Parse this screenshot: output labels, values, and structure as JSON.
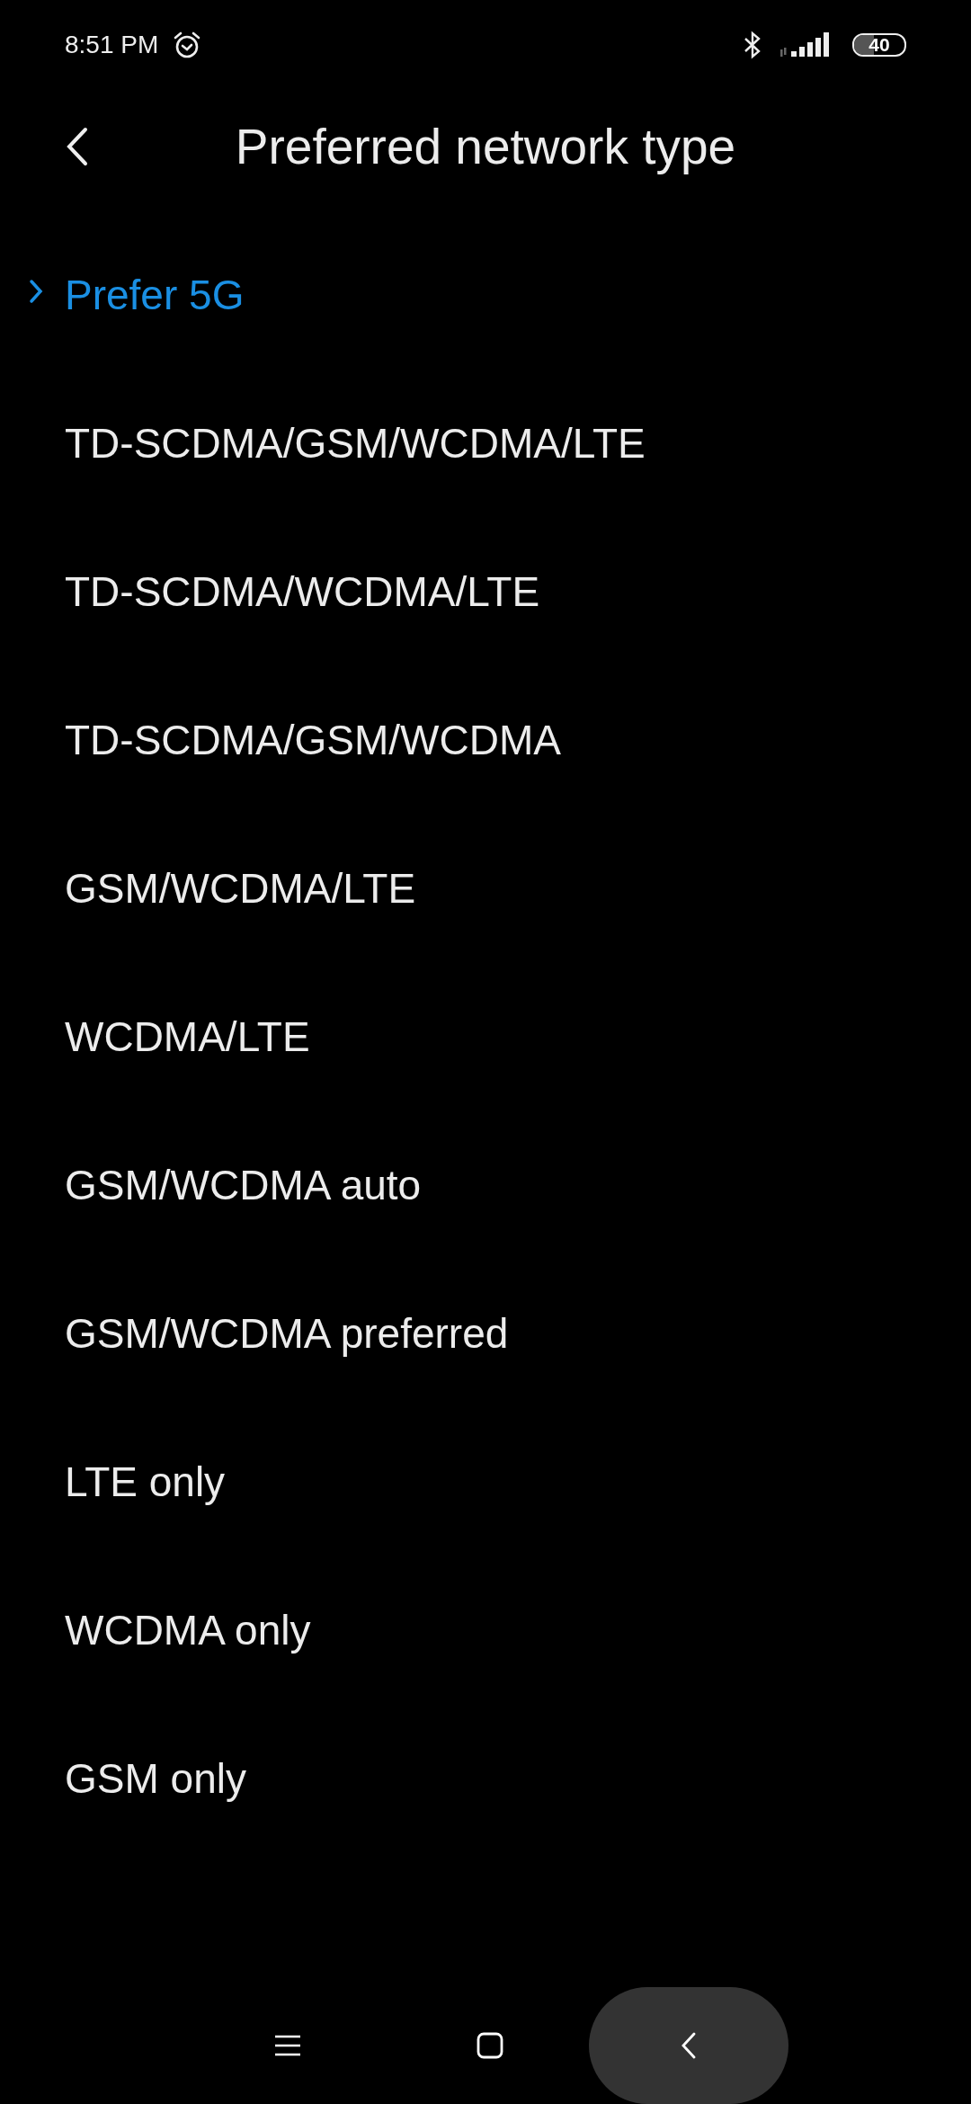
{
  "status_bar": {
    "time": "8:51 PM",
    "battery": "40"
  },
  "title_bar": {
    "title": "Preferred network type"
  },
  "options": [
    {
      "label": "Prefer 5G",
      "selected": true
    },
    {
      "label": "TD-SCDMA/GSM/WCDMA/LTE",
      "selected": false
    },
    {
      "label": "TD-SCDMA/WCDMA/LTE",
      "selected": false
    },
    {
      "label": "TD-SCDMA/GSM/WCDMA",
      "selected": false
    },
    {
      "label": "GSM/WCDMA/LTE",
      "selected": false
    },
    {
      "label": "WCDMA/LTE",
      "selected": false
    },
    {
      "label": "GSM/WCDMA auto",
      "selected": false
    },
    {
      "label": "GSM/WCDMA preferred",
      "selected": false
    },
    {
      "label": "LTE only",
      "selected": false
    },
    {
      "label": "WCDMA only",
      "selected": false
    },
    {
      "label": "GSM only",
      "selected": false
    }
  ]
}
